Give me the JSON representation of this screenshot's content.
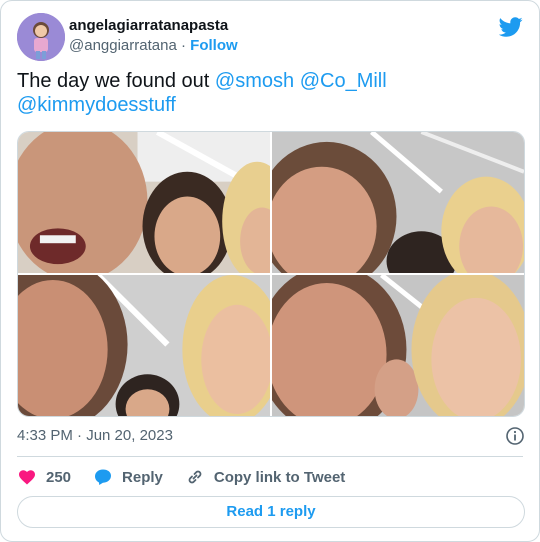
{
  "author": {
    "display_name": "angelagiarratanapasta",
    "handle": "@anggiarratana",
    "separator": "·",
    "follow_label": "Follow"
  },
  "tweet": {
    "text": "The day we found out",
    "mentions": [
      "@smosh",
      "@Co_Mill",
      "@kimmydoesstuff"
    ]
  },
  "media": {
    "photo_count": 4
  },
  "meta": {
    "timestamp": "4:33 PM · Jun 20, 2023"
  },
  "actions": {
    "like_count": "250",
    "reply_label": "Reply",
    "copy_label": "Copy link to Tweet"
  },
  "read_reply_label": "Read 1 reply",
  "colors": {
    "accent": "#1d9bf0",
    "like": "#f91880",
    "text_secondary": "#536471",
    "border": "#cfd9de"
  }
}
